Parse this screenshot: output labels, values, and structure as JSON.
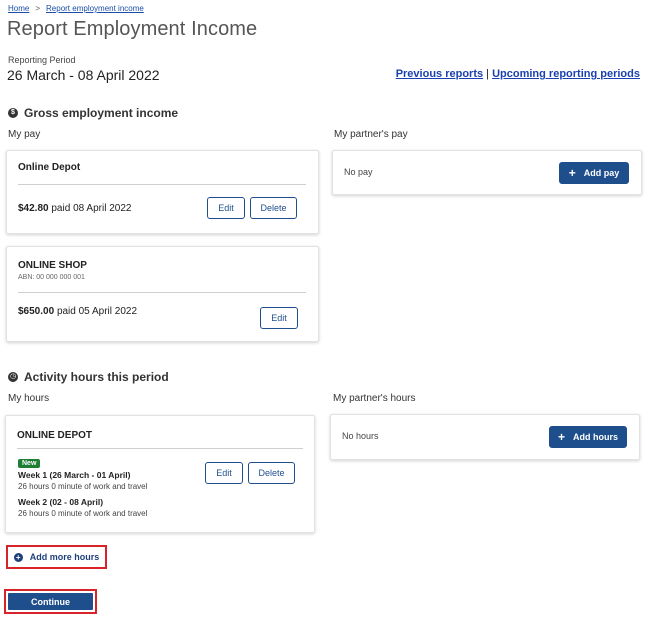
{
  "breadcrumb": {
    "home": "Home",
    "separator": ">",
    "current": "Report employment income"
  },
  "page": {
    "title": "Report Employment Income",
    "period_label": "Reporting Period",
    "period_value": "26 March - 08 April 2022",
    "link_previous": "Previous reports",
    "link_separator": "|",
    "link_upcoming": "Upcoming reporting periods"
  },
  "income": {
    "heading": "Gross employment income",
    "icon": "dollar-circle-icon",
    "my_pay_label": "My pay",
    "partner_pay_label": "My partner's pay",
    "employers": [
      {
        "name": "Online Depot",
        "abn": "",
        "amount": "$42.80",
        "paid_word": "paid",
        "date": "08 April 2022",
        "edit": "Edit",
        "delete": "Delete"
      },
      {
        "name": "ONLINE SHOP",
        "abn": "ABN: 00 000 000 001",
        "amount": "$650.00",
        "paid_word": "paid",
        "date": "05 April 2022",
        "edit": "Edit"
      }
    ],
    "partner": {
      "empty_text": "No pay",
      "add_button": "Add pay"
    }
  },
  "hours": {
    "heading": "Activity hours this period",
    "icon": "clock-icon",
    "my_hours_label": "My hours",
    "partner_hours_label": "My partner's hours",
    "employer": {
      "name": "ONLINE DEPOT",
      "badge": "New",
      "weeks": [
        {
          "title": "Week 1 (26 March - 01 April)",
          "detail": "26 hours 0 minute of work and travel"
        },
        {
          "title": "Week 2 (02 - 08 April)",
          "detail": "26 hours 0 minute of work and travel"
        }
      ],
      "edit": "Edit",
      "delete": "Delete"
    },
    "partner": {
      "empty_text": "No hours",
      "add_button": "Add hours"
    },
    "add_more": "Add more hours"
  },
  "footer": {
    "continue": "Continue"
  },
  "colors": {
    "primary": "#1f4e8c",
    "highlight": "#d8232a",
    "badge": "#1e7e34",
    "link": "#1a3fb0"
  }
}
